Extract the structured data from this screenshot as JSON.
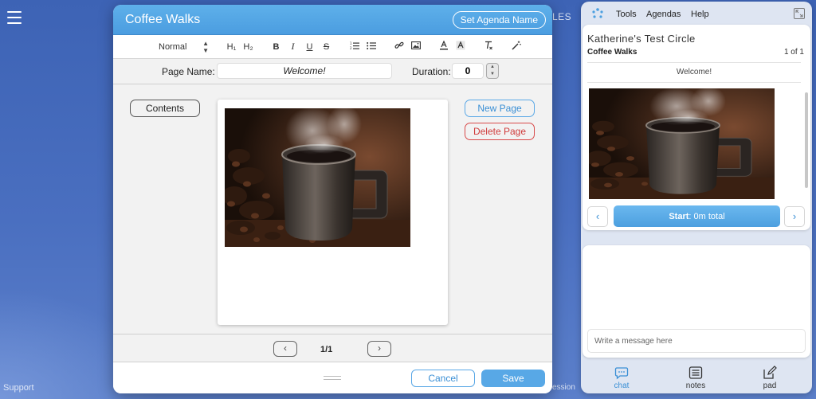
{
  "background": {
    "partial_top_text": "LES",
    "partial_bottom_text": "ession",
    "support_label": "Support"
  },
  "editor": {
    "title": "Coffee Walks",
    "set_agenda_name_label": "Set Agenda Name",
    "toolbar": {
      "style_select": "Normal",
      "h1": "H₁",
      "h2": "H₂",
      "bold": "B",
      "italic": "I",
      "underline": "U",
      "strike": "S"
    },
    "page_name_label": "Page Name:",
    "page_name_value": "Welcome!",
    "duration_label": "Duration:",
    "duration_value": "0",
    "contents_label": "Contents",
    "new_page_label": "New Page",
    "delete_page_label": "Delete Page",
    "pager_text": "1/1",
    "cancel_label": "Cancel",
    "save_label": "Save"
  },
  "side_panel": {
    "menu": {
      "tools": "Tools",
      "agendas": "Agendas",
      "help": "Help"
    },
    "circle_name": "Katherine's Test Circle",
    "agenda_name": "Coffee Walks",
    "page_count": "1 of 1",
    "page_name": "Welcome!",
    "start_label": "Start",
    "start_suffix": ": 0m total",
    "chat_placeholder": "Write a message here",
    "tabs": {
      "chat": "chat",
      "notes": "notes",
      "pad": "pad"
    }
  },
  "colors": {
    "accent": "#58a8e6",
    "danger": "#d03c3c",
    "background": "#4a6fc0"
  }
}
